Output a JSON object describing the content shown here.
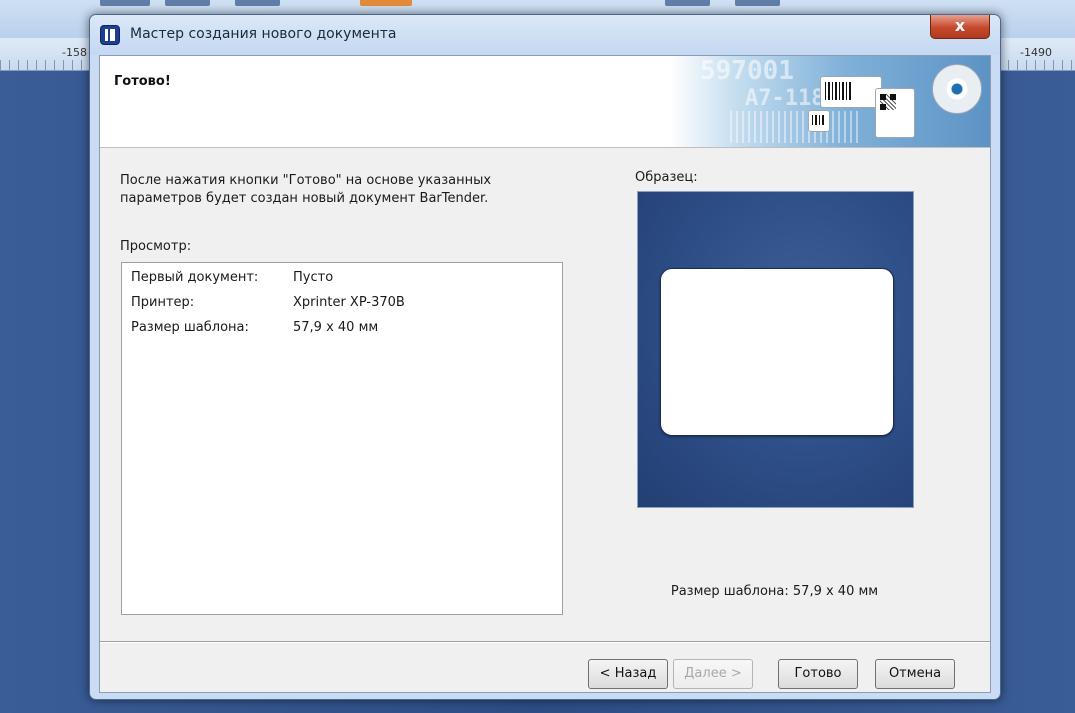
{
  "background_app": {
    "ruler_left_label": "-158",
    "ruler_right_label": "-1490"
  },
  "dialog": {
    "title": "Мастер создания нового документа",
    "close_label": "x",
    "header_title": "Готово!",
    "banner_art_text_1": "597001",
    "banner_art_text_2": "A7-118",
    "intro_text": "После нажатия кнопки \"Готово\" на основе указанных параметров будет создан новый документ BarTender.",
    "preview_label": "Просмотр:",
    "preview_rows": [
      {
        "key": "Первый документ:",
        "value": "Пусто"
      },
      {
        "key": "Принтер:",
        "value": "Xprinter XP-370B"
      },
      {
        "key": "Размер шаблона:",
        "value": "57,9 x 40 мм"
      }
    ],
    "sample_label": "Образец:",
    "sample_size_text": "Размер шаблона:  57,9 x 40 мм",
    "buttons": {
      "back": "< Назад",
      "next": "Далее >",
      "finish": "Готово",
      "cancel": "Отмена"
    }
  },
  "colors": {
    "sample_background": "#2d4d86",
    "close_button": "#c5492d"
  }
}
